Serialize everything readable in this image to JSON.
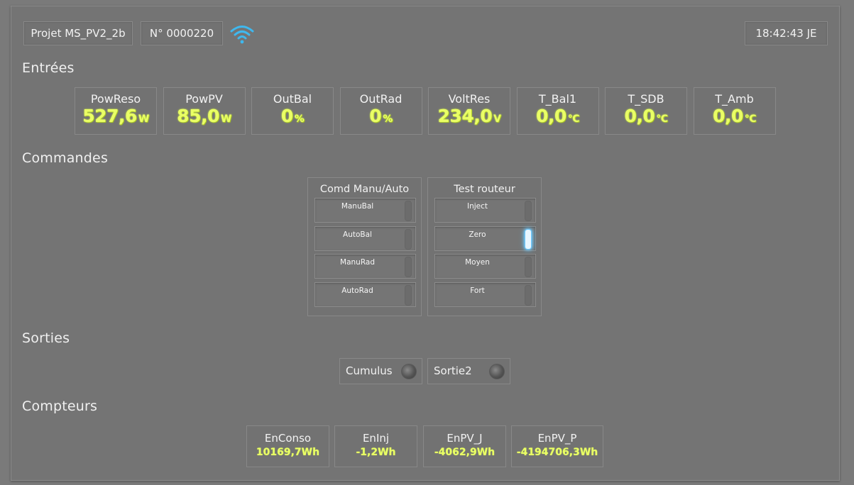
{
  "header": {
    "project": "Projet MS_PV2_2b",
    "serial": "N° 0000220",
    "time": "18:42:43 JE",
    "wifi_icon": "wifi-icon",
    "wifi_color": "#3fb8ee"
  },
  "sections": {
    "inputs": "Entrées",
    "commands": "Commandes",
    "outputs": "Sorties",
    "counters": "Compteurs"
  },
  "inputs": [
    {
      "label": "PowReso",
      "value": "527,6",
      "unit": "W"
    },
    {
      "label": "PowPV",
      "value": "85,0",
      "unit": "W"
    },
    {
      "label": "OutBal",
      "value": "0",
      "unit": "%"
    },
    {
      "label": "OutRad",
      "value": "0",
      "unit": "%"
    },
    {
      "label": "VoltRes",
      "value": "234,0",
      "unit": "V"
    },
    {
      "label": "T_Bal1",
      "value": "0,0",
      "unit": "°C"
    },
    {
      "label": "T_SDB",
      "value": "0,0",
      "unit": "°C"
    },
    {
      "label": "T_Amb",
      "value": "0,0",
      "unit": "°C"
    }
  ],
  "commands": {
    "manu_auto": {
      "title": "Comd Manu/Auto",
      "buttons": [
        {
          "label": "ManuBal",
          "active": false
        },
        {
          "label": "AutoBal",
          "active": false
        },
        {
          "label": "ManuRad",
          "active": false
        },
        {
          "label": "AutoRad",
          "active": false
        }
      ]
    },
    "test": {
      "title": "Test routeur",
      "buttons": [
        {
          "label": "Inject",
          "active": false
        },
        {
          "label": "Zero",
          "active": true
        },
        {
          "label": "Moyen",
          "active": false
        },
        {
          "label": "Fort",
          "active": false
        }
      ]
    }
  },
  "outputs": [
    {
      "label": "Cumulus"
    },
    {
      "label": "Sortie2"
    }
  ],
  "counters": [
    {
      "label": "EnConso",
      "value": "10169,7Wh"
    },
    {
      "label": "EnInj",
      "value": "-1,2Wh"
    },
    {
      "label": "EnPV_J",
      "value": "-4062,9Wh"
    },
    {
      "label": "EnPV_P",
      "value": "-4194706,3Wh"
    }
  ]
}
